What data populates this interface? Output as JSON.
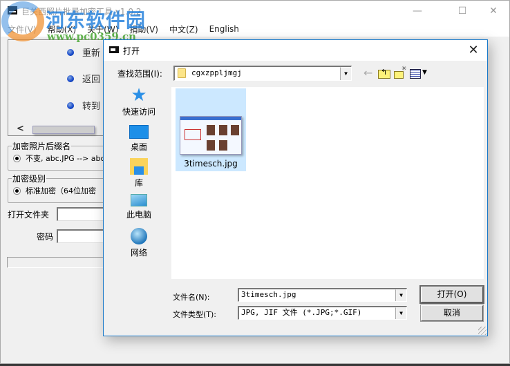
{
  "app": {
    "title": "巨关西照片批量加密工具 v1.0.2",
    "window_controls": {
      "minimize": "—",
      "maximize": "☐",
      "close": "✕"
    },
    "menu": [
      {
        "label": "文件(V)",
        "enabled": false
      },
      {
        "label": "帮助(X)",
        "enabled": true
      },
      {
        "label": "关于(W)",
        "enabled": true
      },
      {
        "label": "捐助(V)",
        "enabled": true
      },
      {
        "label": "中文(Z)",
        "enabled": true
      },
      {
        "label": "English",
        "enabled": true
      }
    ],
    "top_panel_items": [
      "重新",
      "返回",
      "转到"
    ],
    "suffix_group": {
      "label": "加密照片后缀名",
      "option": "不变, abc.JPG --> abc."
    },
    "level_group": {
      "label": "加密级别",
      "option": "标准加密（64位加密"
    },
    "open_folder_label": "打开文件夹",
    "open_folder_value": "",
    "password_label": "密码",
    "password_value": "",
    "progress": 0
  },
  "watermark": {
    "text": "河东软件园",
    "url": "www.pc0359.cn"
  },
  "dialog": {
    "title": "打开",
    "close": "✕",
    "lookin_label": "查找范围(I):",
    "lookin_value": "cgxzppljmgj",
    "toolbar": {
      "back": "←"
    },
    "places": [
      "快速访问",
      "桌面",
      "库",
      "此电脑",
      "网络"
    ],
    "files": [
      {
        "name": "3timesch.jpg",
        "selected": true
      }
    ],
    "filename_label": "文件名(N):",
    "filename_value": "3timesch.jpg",
    "filetype_label": "文件类型(T):",
    "filetype_value": "JPG, JIF 文件 (*.JPG;*.GIF)",
    "open_button": "打开(O)",
    "cancel_button": "取消"
  }
}
